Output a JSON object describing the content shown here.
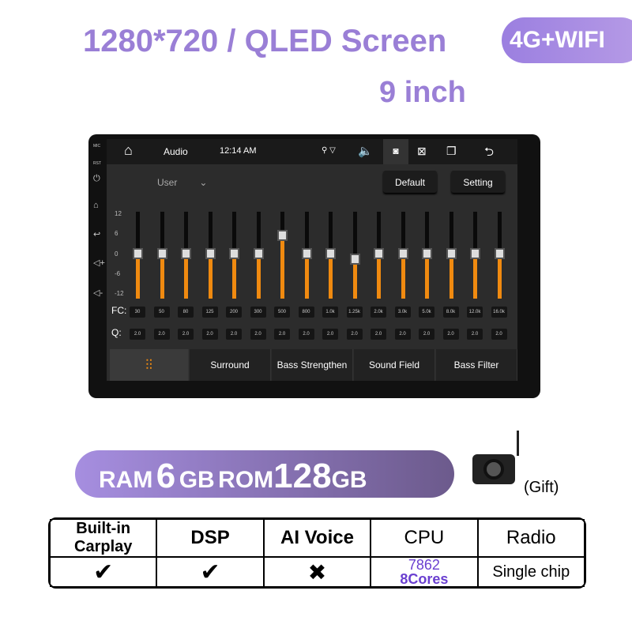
{
  "header": {
    "title": "1280*720 / QLED Screen",
    "size": "9 inch",
    "network": "4G+WIFI"
  },
  "device": {
    "side_labels": [
      "MIC",
      "RST"
    ],
    "status": {
      "app": "Audio",
      "time": "12:14 AM"
    },
    "preset": "User",
    "default_label": "Default",
    "setting_label": "Setting",
    "scale": [
      "12",
      "6",
      "0",
      "-6",
      "-12"
    ],
    "fc_label": "FC:",
    "q_label": "Q:",
    "bands": [
      {
        "fc": "30",
        "q": "2.0",
        "gain": 0
      },
      {
        "fc": "50",
        "q": "2.0",
        "gain": 0
      },
      {
        "fc": "80",
        "q": "2.0",
        "gain": 0
      },
      {
        "fc": "125",
        "q": "2.0",
        "gain": 0
      },
      {
        "fc": "200",
        "q": "2.0",
        "gain": 0
      },
      {
        "fc": "300",
        "q": "2.0",
        "gain": 0
      },
      {
        "fc": "500",
        "q": "2.0",
        "gain": 5
      },
      {
        "fc": "800",
        "q": "2.0",
        "gain": 0
      },
      {
        "fc": "1.0k",
        "q": "2.0",
        "gain": 0
      },
      {
        "fc": "1.25k",
        "q": "2.0",
        "gain": -1.5
      },
      {
        "fc": "2.0k",
        "q": "2.0",
        "gain": 0
      },
      {
        "fc": "3.0k",
        "q": "2.0",
        "gain": 0
      },
      {
        "fc": "5.0k",
        "q": "2.0",
        "gain": 0
      },
      {
        "fc": "8.0k",
        "q": "2.0",
        "gain": 0
      },
      {
        "fc": "12.0k",
        "q": "2.0",
        "gain": 0
      },
      {
        "fc": "16.0k",
        "q": "2.0",
        "gain": 0
      }
    ],
    "tabs": [
      "Surround",
      "Bass Strengthen",
      "Sound Field",
      "Bass Filter"
    ],
    "accent": "#f08a10"
  },
  "memory": {
    "ram_label": "RAM",
    "ram": "6",
    "ram_unit": "GB",
    "rom_label": "ROM",
    "rom": "128",
    "rom_unit": "GB",
    "gift": "(Gift)"
  },
  "specs": {
    "headers": [
      "Built-in Carplay",
      "DSP",
      "AI Voice",
      "CPU",
      "Radio"
    ],
    "values": [
      "✔",
      "✔",
      "✖",
      "7862",
      "Single chip"
    ],
    "cpu_cores": "8Cores"
  }
}
